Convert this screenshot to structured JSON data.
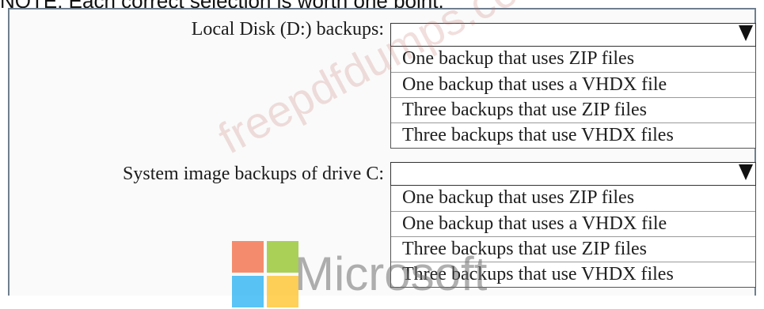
{
  "note": "NOTE: Each correct selection is worth one point.",
  "watermark_text": "freepdfdumps.com",
  "logo": {
    "text": "Microsoft",
    "colors": [
      "#f25022",
      "#7fba00",
      "#00a4ef",
      "#ffb900"
    ]
  },
  "questions": [
    {
      "label": "Local Disk (D:) backups:",
      "selected": "",
      "options": [
        "One backup that uses ZIP files",
        "One backup that uses a VHDX file",
        "Three backups that use ZIP files",
        "Three backups that use VHDX files"
      ]
    },
    {
      "label": "System image backups of drive C:",
      "selected": "",
      "options": [
        "One backup that uses ZIP files",
        "One backup that uses a VHDX file",
        "Three backups that use ZIP files",
        "Three backups that use VHDX files"
      ]
    }
  ]
}
